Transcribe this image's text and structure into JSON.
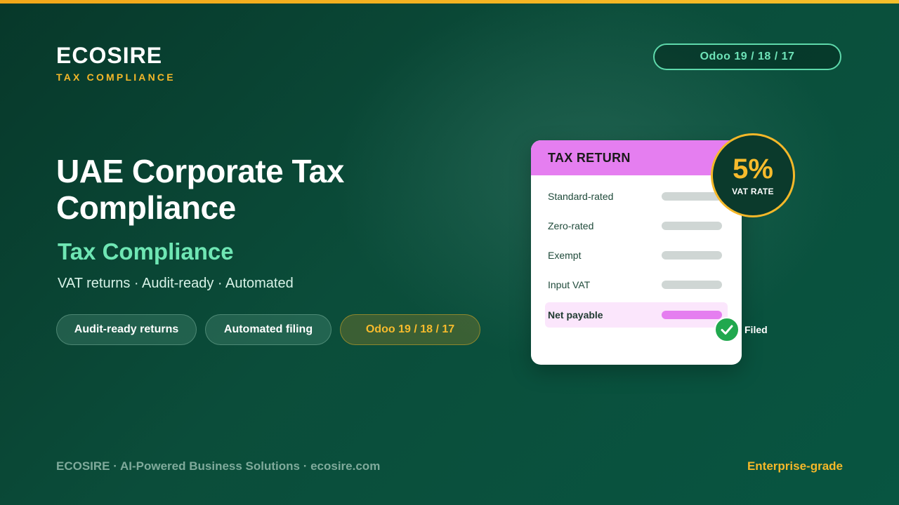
{
  "brand": {
    "name": "ECOSIRE",
    "tagline": "TAX COMPLIANCE"
  },
  "version_pill": "Odoo 19 / 18 / 17",
  "hero": {
    "title": "UAE Corporate Tax Compliance",
    "subtitle": "Tax Compliance",
    "features": "VAT returns · Audit-ready · Automated"
  },
  "chips": [
    {
      "label": "Audit-ready returns"
    },
    {
      "label": "Automated filing"
    },
    {
      "label": "Odoo 19 / 18 / 17"
    }
  ],
  "tax_card": {
    "header": "TAX RETURN",
    "rows": [
      {
        "label": "Standard-rated"
      },
      {
        "label": "Zero-rated"
      },
      {
        "label": "Exempt"
      },
      {
        "label": "Input VAT"
      },
      {
        "label": "Net payable"
      }
    ]
  },
  "vat_badge": {
    "value": "5%",
    "label": "VAT RATE"
  },
  "filed": {
    "label": "Filed",
    "icon": "check-icon"
  },
  "footer": {
    "left": "ECOSIRE · AI-Powered Business Solutions · ecosire.com",
    "right": "Enterprise-grade"
  },
  "colors": {
    "accent_gold": "#f5b829",
    "accent_mint": "#6fe6b4",
    "accent_pink": "#e57ef0",
    "background": "#0b4d3a",
    "success": "#21a84e"
  }
}
